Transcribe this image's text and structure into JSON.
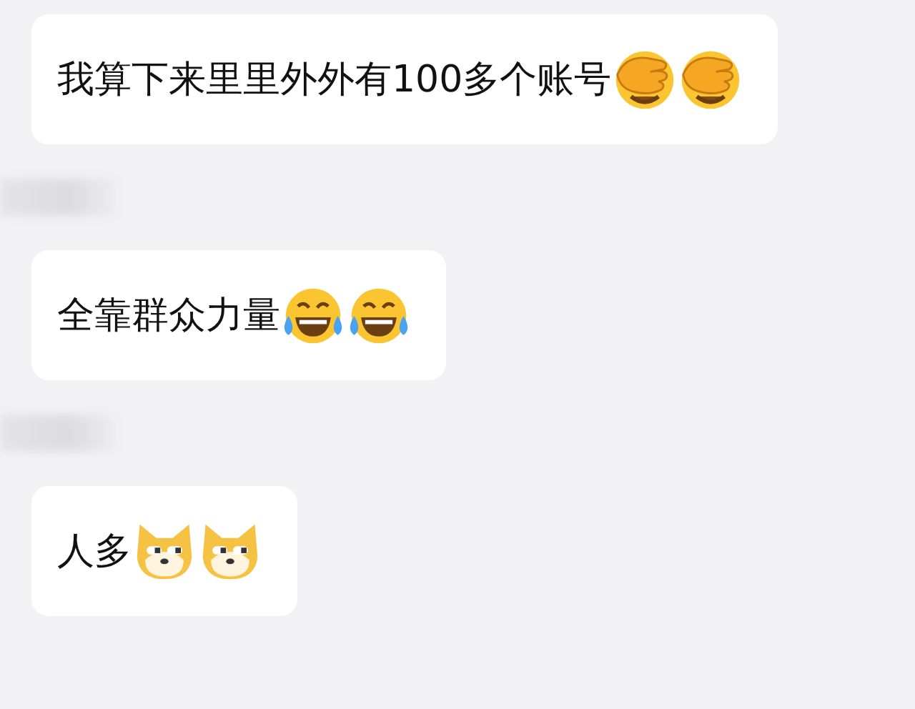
{
  "messages": [
    {
      "kind": "message",
      "text": "我算下来里里外外有100多个账号",
      "emojis": [
        {
          "kind": "facepalm"
        },
        {
          "kind": "facepalm"
        }
      ]
    },
    {
      "kind": "name-blur"
    },
    {
      "kind": "message",
      "text": "全靠群众力量",
      "emojis": [
        {
          "kind": "laugh"
        },
        {
          "kind": "laugh"
        }
      ]
    },
    {
      "kind": "name-blur"
    },
    {
      "kind": "message",
      "text": "人多",
      "emojis": [
        {
          "kind": "dog"
        },
        {
          "kind": "dog"
        }
      ]
    }
  ]
}
